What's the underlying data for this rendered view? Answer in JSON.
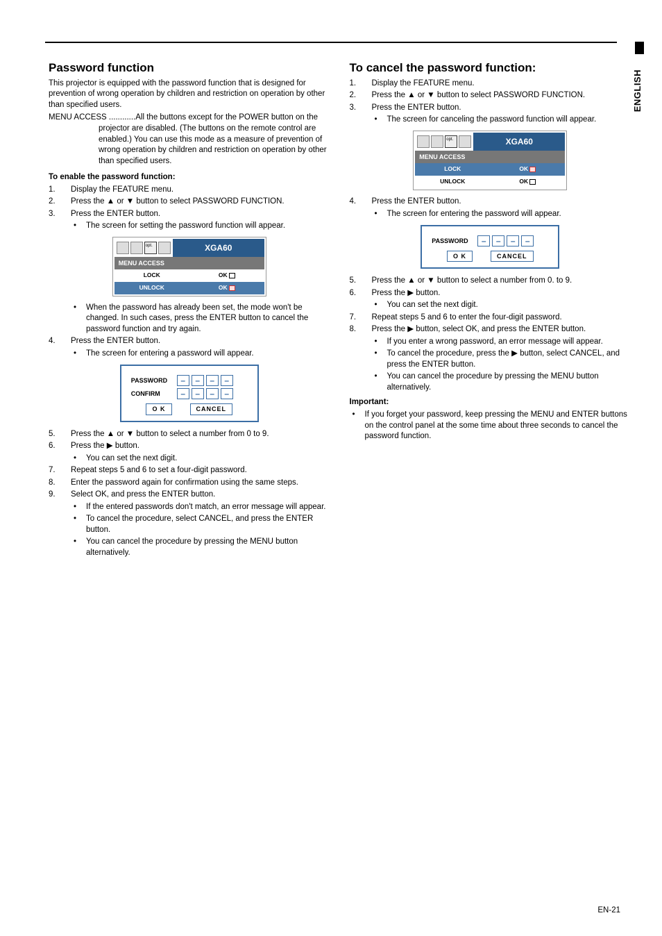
{
  "page": {
    "lang_tab": "ENGLISH",
    "footer": "EN-21"
  },
  "left": {
    "h": "Password function",
    "intro1": "This projector is equipped with the password function that is designed for prevention of wrong operation by children and restriction on operation by other than specified users.",
    "menuaccess": "MENU ACCESS ............All the buttons except for the POWER button on the projector are disabled. (The buttons on the remote control are enabled.) You can use this mode as a measure of prevention of wrong operation by children and restriction on operation by other than specified users.",
    "enable_h": "To enable the password function:",
    "s1": "Display the FEATURE menu.",
    "s2_a": "Press the ",
    "s2_b": " or ",
    "s2_c": " button to select PASSWORD FUNCTION.",
    "s3": "Press the ENTER button.",
    "s3b": "The screen for setting the password function will appear.",
    "fig1": {
      "title": "XGA60",
      "sub": "MENU ACCESS",
      "r1": "LOCK",
      "r1b": "OK",
      "r2": "UNLOCK",
      "r2b": "OK"
    },
    "after_fig1": "When the password has already been set, the mode won't be changed. In such cases, press the ENTER button to cancel the password function and try again.",
    "s4": "Press the ENTER button.",
    "s4b": "The screen for entering a password will appear.",
    "fig2": {
      "l1": "PASSWORD",
      "l2": "CONFIRM",
      "ok": "O K",
      "cancel": "CANCEL"
    },
    "s5_a": "Press the ",
    "s5_b": " or ",
    "s5_c": " button to select a number from 0 to 9.",
    "s6_a": "Press the ",
    "s6_b": " button.",
    "s6b": "You can set the next digit.",
    "s7": "Repeat steps 5 and 6 to set a four-digit password.",
    "s8": "Enter the password again for confirmation using the same steps.",
    "s9": "Select OK, and press the ENTER button.",
    "s9b1": "If the entered passwords don't match, an error message will appear.",
    "s9b2": "To cancel the procedure, select CANCEL, and press the ENTER button.",
    "s9b3": "You can cancel the procedure by pressing the MENU button alternatively."
  },
  "right": {
    "h": "To cancel the password function:",
    "s1": "Display the FEATURE menu.",
    "s2_a": "Press the ",
    "s2_b": " or ",
    "s2_c": " button to select PASSWORD FUNCTION.",
    "s3": "Press the ENTER button.",
    "s3b": "The screen for canceling the password function will appear.",
    "fig1": {
      "title": "XGA60",
      "sub": "MENU ACCESS",
      "r1": "LOCK",
      "r1b": "OK",
      "r2": "UNLOCK",
      "r2b": "OK"
    },
    "s4": "Press the ENTER button.",
    "s4b": "The screen for entering the password will appear.",
    "fig2": {
      "l1": "PASSWORD",
      "ok": "O K",
      "cancel": "CANCEL"
    },
    "s5_a": "Press the ",
    "s5_b": " or ",
    "s5_c": " button to select a number from 0. to 9.",
    "s6_a": "Press the ",
    "s6_b": " button.",
    "s6b": "You can set the next digit.",
    "s7": "Repeat steps 5 and 6 to enter the four-digit password.",
    "s8_a": "Press the ",
    "s8_b": " button, select OK, and press the ENTER button.",
    "s8b1": "If you enter a wrong password, an error message will appear.",
    "s8b2_a": "To cancel the procedure, press the ",
    "s8b2_b": " button, select CANCEL, and press the ENTER button.",
    "s8b3": "You can cancel the procedure by pressing the MENU button alternatively.",
    "imp_h": "Important:",
    "imp_b": "If you forget your password, keep pressing the MENU and ENTER buttons on the control panel at the some time about three seconds to cancel the password function."
  }
}
